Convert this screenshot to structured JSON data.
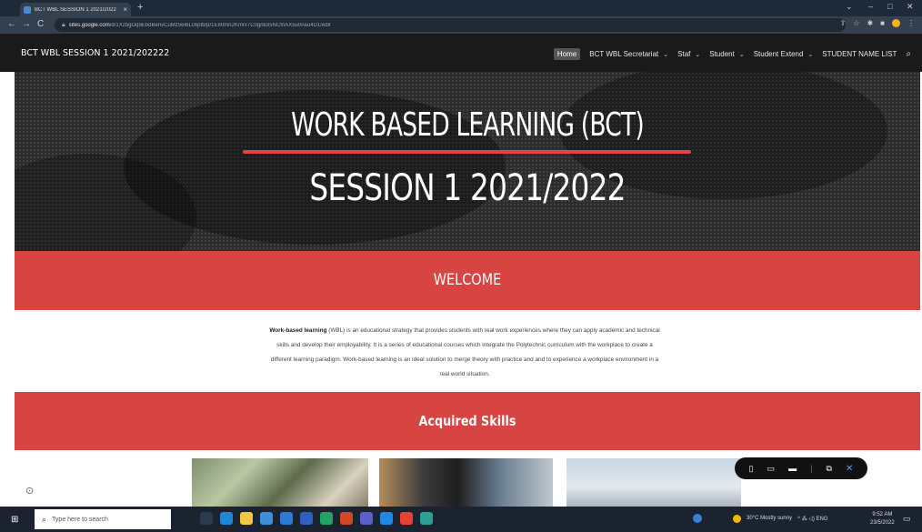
{
  "browser": {
    "tab_title": "BCT WBL SESSION 1 2021/2022",
    "tab_close": "×",
    "new_tab": "+",
    "url_host": "sites.google.com",
    "url_path": "/d/1XzbgOq9EbdBenvCuMz56I6Lc6ptb/p/1E80mn2Kmrx7C0gnb35NCfnAX5u0neu4D1/edit",
    "nav_back": "←",
    "nav_forward": "→",
    "nav_reload": "C",
    "win_min": "–",
    "win_max": "□",
    "win_close": "✕"
  },
  "site": {
    "title": "BCT WBL SESSION 1 2021/202222",
    "menu": [
      {
        "label": "Home",
        "has_dropdown": false
      },
      {
        "label": "BCT WBL Secretariat",
        "has_dropdown": true
      },
      {
        "label": "Staf",
        "has_dropdown": true
      },
      {
        "label": "Student",
        "has_dropdown": true
      },
      {
        "label": "Student Extend",
        "has_dropdown": true
      },
      {
        "label": "STUDENT NAME LIST",
        "has_dropdown": false
      }
    ],
    "search_icon": "⌕",
    "chevron": "⌄"
  },
  "hero": {
    "heading": "WORK BASED LEARNING (BCT)",
    "subheading": "SESSION 1 2021/2022"
  },
  "welcome": {
    "title": "WELCOME",
    "term": "Work-based learning",
    "abbr": " (WBL)",
    "body": " is an educational strategy that provides students with real work experiences where they can apply academic and technical skills and develop their employability. It is a series of educational courses which integrate the Polytechnic curriculum with the workplace to create a different learning paradigm. Work-based learning is an ideal solution to merge theory with practice and and to experience a workplace environment in a real world situation."
  },
  "skills": {
    "title": "Acquired Skills"
  },
  "floating_toolbar": {
    "icons": [
      "▯",
      "▭",
      "▬",
      "|",
      "⧉",
      "✕"
    ]
  },
  "taskbar": {
    "search_placeholder": "Type here to search",
    "weather": "30°C Mostly sunny",
    "tray_text": "^ ⁂ ◁) ENG",
    "time": "9:52 AM",
    "date": "23/5/2022"
  },
  "colors": {
    "accent_red": "#d64541",
    "header_bg": "#1a1a1a",
    "hero_underline": "#e0463f"
  }
}
